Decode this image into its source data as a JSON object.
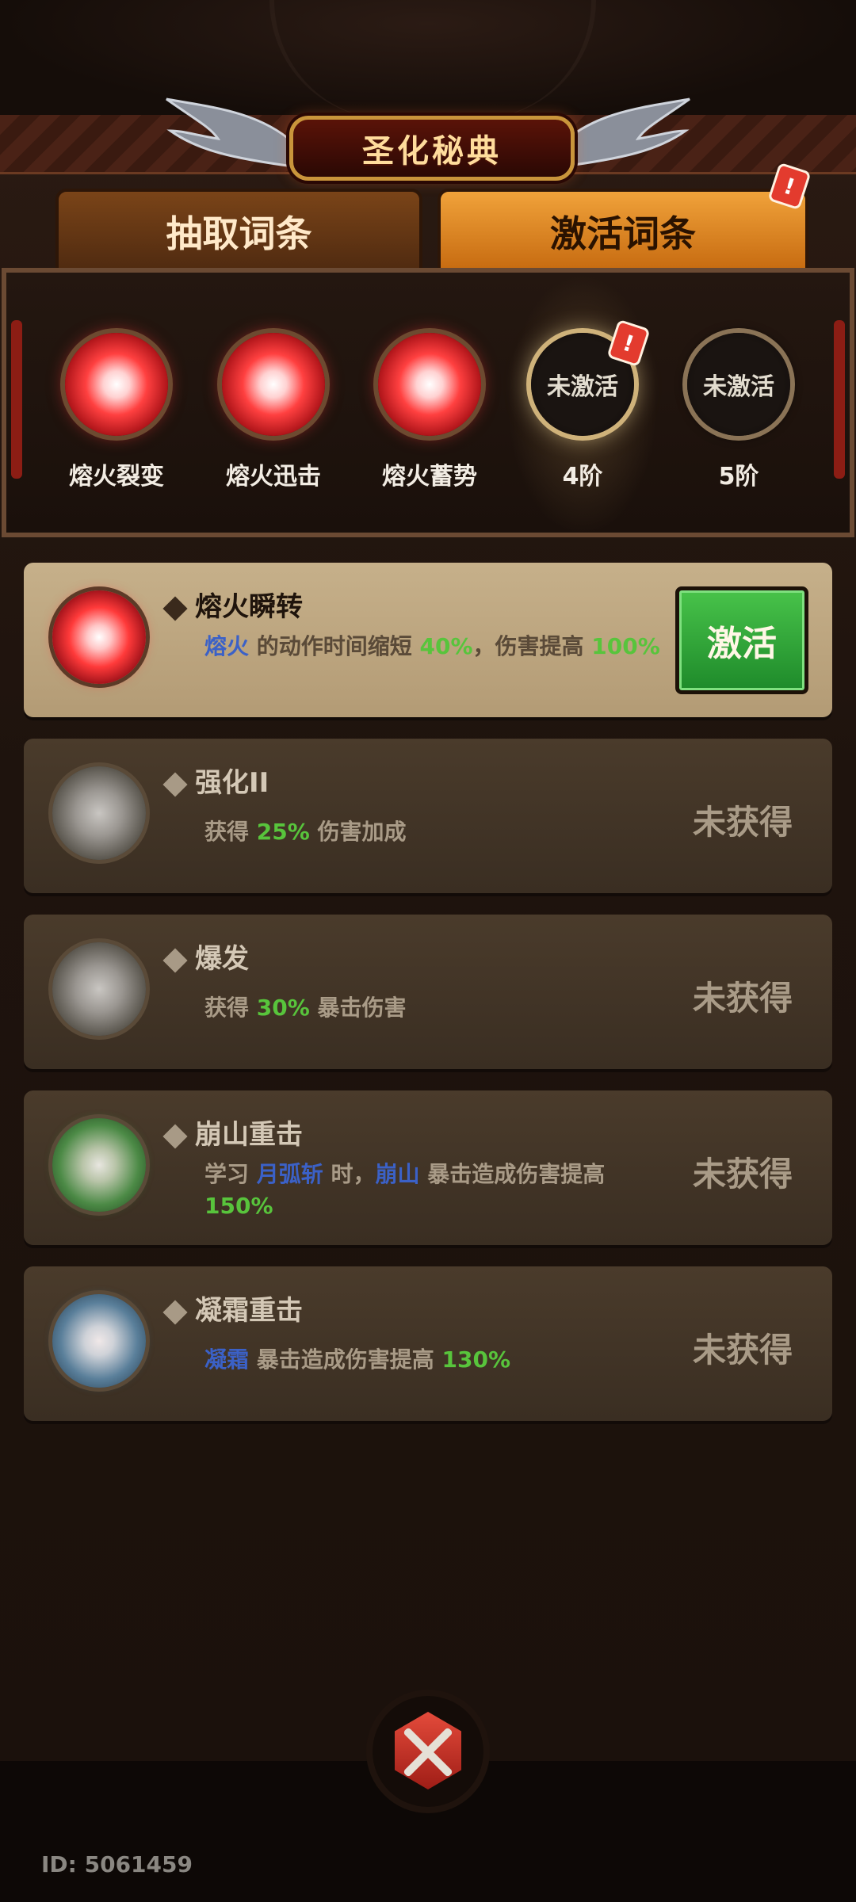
{
  "header": {
    "title": "圣化秘典",
    "tabs": [
      {
        "label": "抽取词条",
        "active": false
      },
      {
        "label": "激活词条",
        "active": true,
        "badge": "!"
      }
    ]
  },
  "tiers": [
    {
      "label": "熔火裂变",
      "state": "activated",
      "color": "#ff3a3a"
    },
    {
      "label": "熔火迅击",
      "state": "activated",
      "color": "#ff3a3a"
    },
    {
      "label": "熔火蓄势",
      "state": "activated",
      "color": "#ff3a3a"
    },
    {
      "label": "4阶",
      "orb_text": "未激活",
      "state": "selected",
      "badge": "!"
    },
    {
      "label": "5阶",
      "orb_text": "未激活",
      "state": "locked"
    }
  ],
  "entries": [
    {
      "title": "熔火瞬转",
      "desc_parts": [
        "熔火",
        " 的动作时间缩短 ",
        "40%",
        "，伤害提高 ",
        "100%"
      ],
      "button": "激活",
      "orb": "red"
    },
    {
      "title": "强化II",
      "desc_parts": [
        "获得 ",
        "25%",
        " 伤害加成"
      ],
      "status": "未获得",
      "orb": "gray"
    },
    {
      "title": "爆发",
      "desc_parts": [
        "获得 ",
        "30%",
        " 暴击伤害"
      ],
      "status": "未获得",
      "orb": "gray"
    },
    {
      "title": "崩山重击",
      "desc_parts": [
        "学习 ",
        "月弧斩",
        " 时，",
        "崩山",
        " 暴击造成伤害提高 ",
        "150%"
      ],
      "status": "未获得",
      "orb": "green"
    },
    {
      "title": "凝霜重击",
      "desc_parts": [
        "凝霜",
        " 暴击造成伤害提高 ",
        "130%"
      ],
      "status": "未获得",
      "orb": "blue"
    }
  ],
  "footer": {
    "user_id": "ID: 5061459",
    "close_icon": "crossed-swords-icon"
  },
  "colors": {
    "accent": "#f0a23a",
    "highlight_blue": "#3b61c7",
    "highlight_green": "#58c43c",
    "activate_button": "#2ea63a",
    "badge_red": "#e33b2e"
  }
}
